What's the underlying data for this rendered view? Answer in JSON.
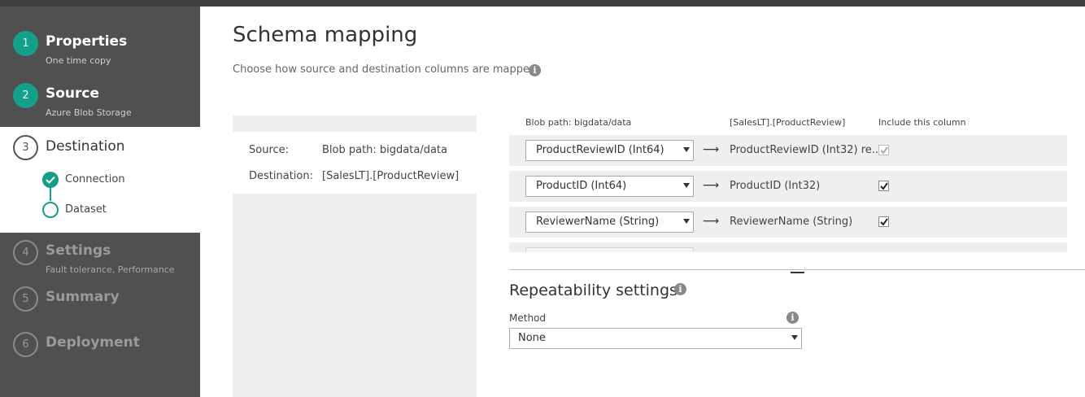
{
  "sidebar": {
    "steps": [
      {
        "number": "1",
        "title": "Properties",
        "subtitle": "One time copy"
      },
      {
        "number": "2",
        "title": "Source",
        "subtitle": "Azure Blob Storage"
      },
      {
        "number": "3",
        "title": "Destination",
        "subtitle": ""
      },
      {
        "number": "4",
        "title": "Settings",
        "subtitle": "Fault tolerance, Performance"
      },
      {
        "number": "5",
        "title": "Summary",
        "subtitle": ""
      },
      {
        "number": "6",
        "title": "Deployment",
        "subtitle": ""
      }
    ],
    "substeps": [
      {
        "label": "Connection",
        "state": "done"
      },
      {
        "label": "Dataset",
        "state": "current"
      }
    ]
  },
  "main": {
    "title": "Schema mapping",
    "subtitle": "Choose how source and destination columns are mapped",
    "summary": {
      "source_label": "Source:",
      "source_value": "Blob path: bigdata/data",
      "destination_label": "Destination:",
      "destination_value": "[SalesLT].[ProductReview]"
    },
    "columns": {
      "source_header": "Blob path: bigdata/data",
      "destination_header": "[SalesLT].[ProductReview]",
      "include_header": "Include this column"
    },
    "mappings": [
      {
        "source": "ProductReviewID (Int64)",
        "destination": "ProductReviewID (Int32) re...",
        "included": true,
        "disabled": true
      },
      {
        "source": "ProductID (Int64)",
        "destination": "ProductID (Int32)",
        "included": true,
        "disabled": false
      },
      {
        "source": "ReviewerName (String)",
        "destination": "ReviewerName (String)",
        "included": true,
        "disabled": false
      }
    ],
    "arrow_glyph": "⟶",
    "repeatability": {
      "title": "Repeatability settings",
      "method_label": "Method",
      "method_value": "None"
    }
  },
  "colors": {
    "accent": "#14a088",
    "sidebar_bg": "#505050",
    "row_bg": "#efefef"
  }
}
